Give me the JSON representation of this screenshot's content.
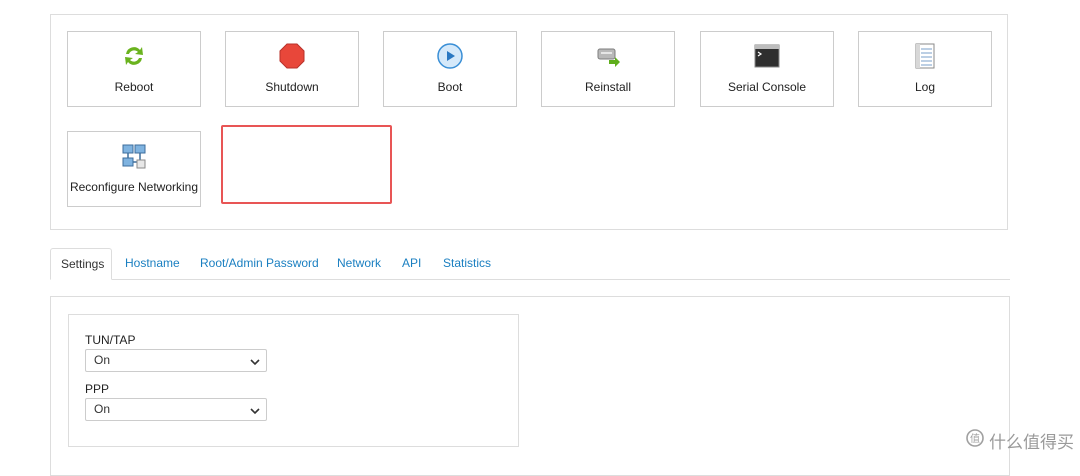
{
  "actions": {
    "row1": [
      {
        "label": "Reboot",
        "icon": "reboot-icon"
      },
      {
        "label": "Shutdown",
        "icon": "shutdown-icon"
      },
      {
        "label": "Boot",
        "icon": "boot-icon"
      },
      {
        "label": "Reinstall",
        "icon": "reinstall-icon"
      },
      {
        "label": "Serial Console",
        "icon": "console-icon"
      },
      {
        "label": "Log",
        "icon": "log-icon"
      }
    ],
    "row2": [
      {
        "label": "Reconfigure Networking",
        "icon": "network-icon"
      }
    ]
  },
  "tabs": [
    {
      "label": "Settings",
      "active": true
    },
    {
      "label": "Hostname"
    },
    {
      "label": "Root/Admin Password"
    },
    {
      "label": "Network"
    },
    {
      "label": "API"
    },
    {
      "label": "Statistics"
    }
  ],
  "settings": {
    "tuntap": {
      "label": "TUN/TAP",
      "value": "On"
    },
    "ppp": {
      "label": "PPP",
      "value": "On"
    }
  },
  "watermark": {
    "text": "什么值得买"
  },
  "colors": {
    "link": "#1a7fc1",
    "highlight": "#e85555",
    "border": "#dddddd"
  }
}
